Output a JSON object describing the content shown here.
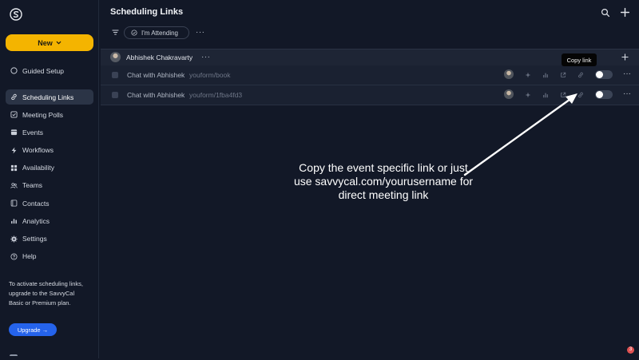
{
  "sidebar": {
    "new_label": "New",
    "guided_setup": "Guided Setup",
    "items": [
      {
        "label": "Scheduling Links",
        "icon": "link-icon",
        "active": true
      },
      {
        "label": "Meeting Polls",
        "icon": "poll-icon"
      },
      {
        "label": "Events",
        "icon": "calendar-icon"
      },
      {
        "label": "Workflows",
        "icon": "lightning-icon"
      },
      {
        "label": "Availability",
        "icon": "grid-icon"
      },
      {
        "label": "Teams",
        "icon": "people-icon"
      },
      {
        "label": "Contacts",
        "icon": "contact-book-icon"
      },
      {
        "label": "Analytics",
        "icon": "bar-chart-icon"
      },
      {
        "label": "Settings",
        "icon": "gear-icon"
      },
      {
        "label": "Help",
        "icon": "question-icon"
      }
    ],
    "upgrade_text": "To activate scheduling links, upgrade to the SavvyCal Basic or Premium plan.",
    "upgrade_button": "Upgrade →"
  },
  "header": {
    "title": "Scheduling Links",
    "filter_chip": "I'm Attending",
    "more": "···"
  },
  "group": {
    "owner": "Abhishek Chakravarty",
    "more": "···"
  },
  "rows": [
    {
      "title": "Chat with Abhishek",
      "slug": "youform/book",
      "more": "···"
    },
    {
      "title": "Chat with Abhishek",
      "slug": "youform/1fba4fd3",
      "more": "···"
    }
  ],
  "tooltip": "Copy link",
  "annotation": {
    "line1": "Copy the event specific link or just",
    "line2": "use savvycal.com/yourusername for",
    "line3": "direct meeting link"
  },
  "notification_count": "3",
  "colors": {
    "accent_new": "#f4b400",
    "upgrade_blue": "#2563eb",
    "background": "#121827"
  }
}
